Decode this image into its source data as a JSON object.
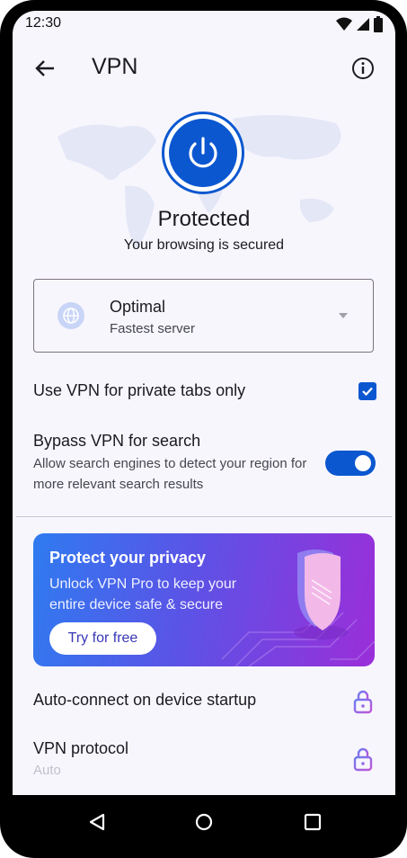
{
  "status_bar": {
    "time": "12:30"
  },
  "app_bar": {
    "title": "VPN",
    "back_icon": "arrow-back-icon",
    "info_icon": "info-icon"
  },
  "hero": {
    "status_title": "Protected",
    "status_subtitle": "Your browsing is secured",
    "accent": "#0b57d0"
  },
  "server": {
    "name": "Optimal",
    "description": "Fastest server"
  },
  "settings": {
    "private_tabs_label": "Use VPN for private tabs only",
    "private_tabs_checked": true,
    "bypass_title": "Bypass VPN for search",
    "bypass_description": "Allow search engines to detect your region for more relevant search results",
    "bypass_enabled": true
  },
  "promo": {
    "title": "Protect your privacy",
    "body": "Unlock VPN Pro to keep your entire device safe & secure",
    "button": "Try for free"
  },
  "pro_settings": {
    "autoconnect_label": "Auto-connect on device startup",
    "protocol_label": "VPN protocol",
    "protocol_value": "Auto"
  }
}
